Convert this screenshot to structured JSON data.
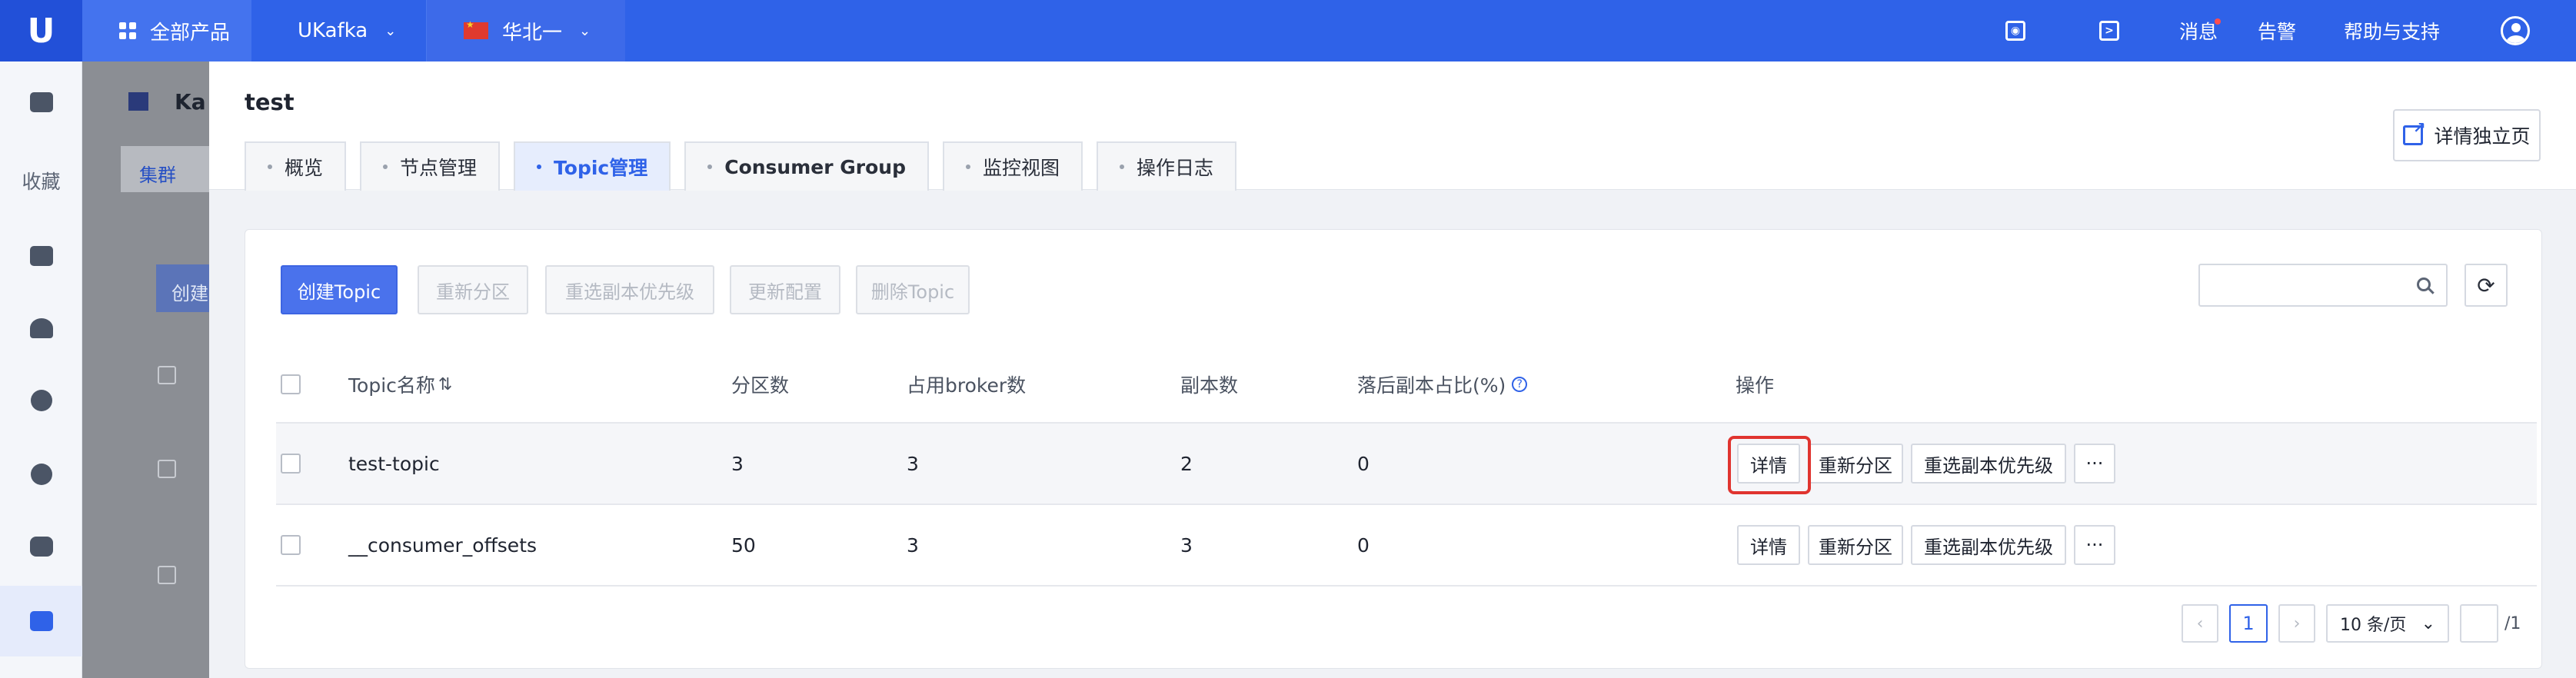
{
  "topbar": {
    "logo": "U",
    "all_products": "全部产品",
    "product": "UKafka",
    "region": "华北一",
    "messages": "消息",
    "alarm": "告警",
    "help": "帮助与支持"
  },
  "sidebar": {
    "favorites": "收藏"
  },
  "backdrop": {
    "title": "Ka",
    "tab": "集群",
    "create": "创建"
  },
  "drawer": {
    "title": "test",
    "detail_page_button": "详情独立页",
    "tabs": [
      "概览",
      "节点管理",
      "Topic管理",
      "Consumer Group",
      "监控视图",
      "操作日志"
    ]
  },
  "toolbar": {
    "create_topic": "创建Topic",
    "repartition": "重新分区",
    "reelect_priority": "重选副本优先级",
    "update_config": "更新配置",
    "delete_topic": "删除Topic"
  },
  "table": {
    "columns": [
      "Topic名称",
      "分区数",
      "占用broker数",
      "副本数",
      "落后副本占比(%)",
      "操作"
    ],
    "rows": [
      {
        "name": "test-topic",
        "partitions": "3",
        "brokers": "3",
        "replicas": "2",
        "lag": "0"
      },
      {
        "name": "__consumer_offsets",
        "partitions": "50",
        "brokers": "3",
        "replicas": "3",
        "lag": "0"
      }
    ],
    "actions": {
      "detail": "详情",
      "repartition": "重新分区",
      "reelect": "重选副本优先级",
      "more": "···"
    }
  },
  "pagination": {
    "prev": "‹",
    "current": "1",
    "next": "›",
    "page_size": "10 条/页",
    "total_pages": "/1"
  }
}
